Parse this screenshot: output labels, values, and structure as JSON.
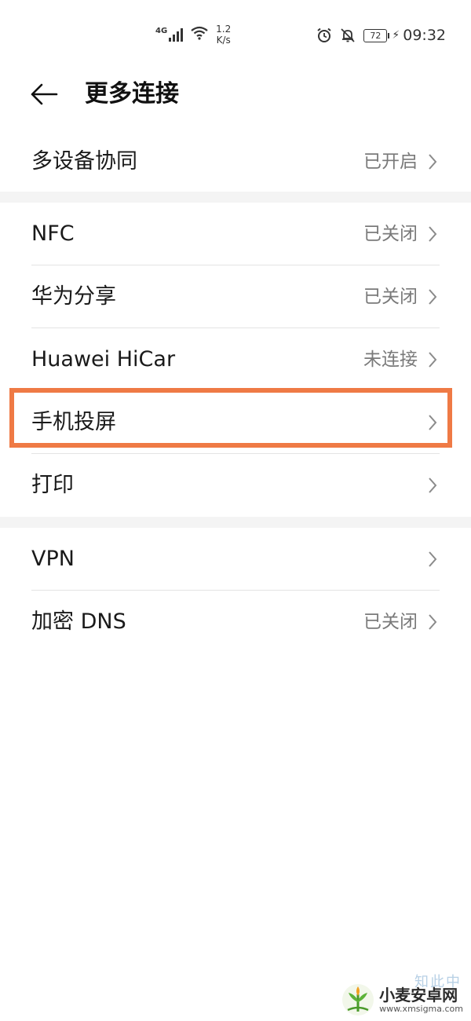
{
  "status_bar": {
    "network": "4G",
    "speed_value": "1.2",
    "speed_unit": "K/s",
    "battery": "72",
    "time": "09:32",
    "icons": [
      "signal-icon",
      "wifi-icon",
      "alarm-icon",
      "mute-icon",
      "battery-icon",
      "charging-icon"
    ]
  },
  "header": {
    "back_icon": "arrow-left-icon",
    "title": "更多连接"
  },
  "sections": [
    {
      "items": [
        {
          "label": "多设备协同",
          "value": "已开启"
        }
      ]
    },
    {
      "items": [
        {
          "label": "NFC",
          "value": "已关闭"
        },
        {
          "label": "华为分享",
          "value": "已关闭"
        },
        {
          "label": "Huawei HiCar",
          "value": "未连接"
        },
        {
          "label": "手机投屏",
          "value": "",
          "highlighted": true
        },
        {
          "label": "打印",
          "value": ""
        }
      ]
    },
    {
      "items": [
        {
          "label": "VPN",
          "value": ""
        },
        {
          "label": "加密 DNS",
          "value": "已关闭"
        }
      ]
    }
  ],
  "highlight_color": "#ef7a45",
  "watermark": {
    "faint_text": "知此中",
    "brand": "小麦安卓网",
    "url": "www.xmsigma.com"
  }
}
